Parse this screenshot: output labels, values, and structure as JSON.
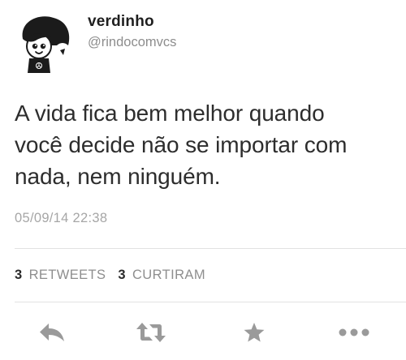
{
  "author": {
    "name": "verdinho",
    "handle": "@rindocomvcs"
  },
  "tweet": {
    "text_lines": [
      "A vida fica bem melhor quando",
      "você decide não se importar com",
      "nada, nem ninguém."
    ],
    "timestamp": "05/09/14 22:38"
  },
  "stats": {
    "retweets_count": "3",
    "retweets_label": "RETWEETS",
    "favorites_count": "3",
    "favorites_label": "CURTIRAM"
  },
  "actions": [
    {
      "icon": "reply-icon"
    },
    {
      "icon": "retweet-icon"
    },
    {
      "icon": "star-icon"
    },
    {
      "icon": "more-icon"
    }
  ],
  "colors": {
    "text": "#2d2d2d",
    "secondary": "#8d8d8d",
    "timestamp": "#a6a6a6",
    "icons": "#9a9a9a",
    "divider": "#e2e2e2"
  }
}
